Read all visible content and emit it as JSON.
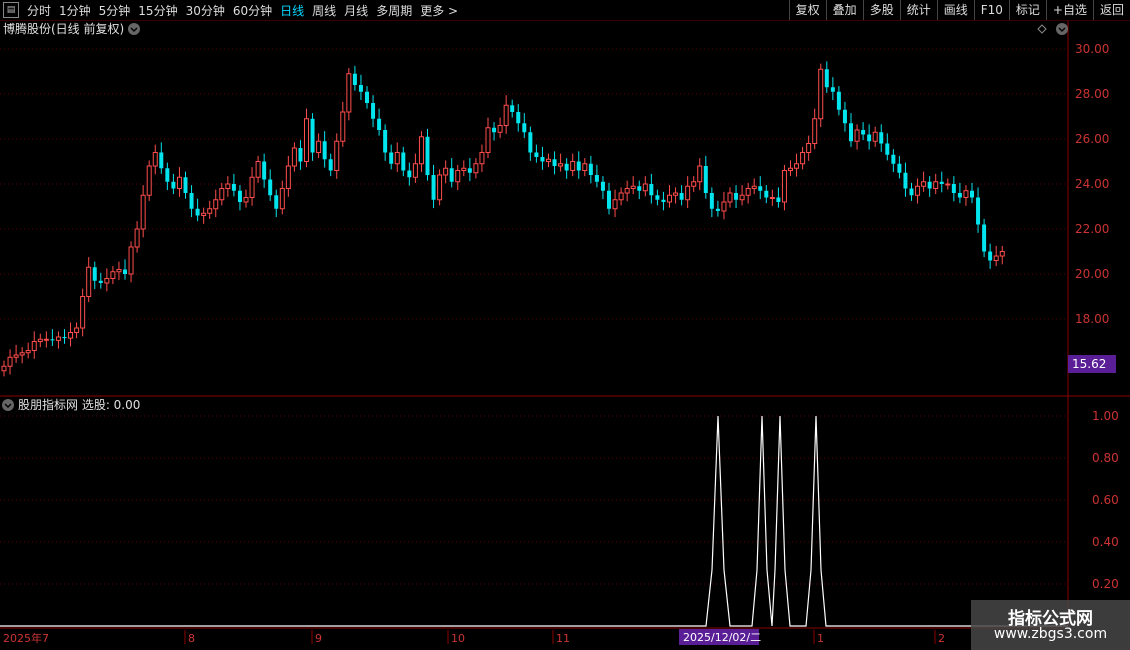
{
  "toolbar": {
    "periods": [
      "分时",
      "1分钟",
      "5分钟",
      "15分钟",
      "30分钟",
      "60分钟",
      "日线",
      "周线",
      "月线",
      "多周期",
      "更多 >"
    ],
    "active_period": "日线",
    "tools": [
      "复权",
      "叠加",
      "多股",
      "统计",
      "画线",
      "F10",
      "标记",
      "+自选",
      "返回"
    ]
  },
  "main_chart": {
    "title": "博腾股份(日线 前复权)",
    "price_ticks": [
      "30.00",
      "28.00",
      "26.00",
      "24.00",
      "22.00",
      "20.00",
      "18.00"
    ],
    "current_price_badge": "15.62"
  },
  "indicator": {
    "title": "股朋指标网 选股: 0.00",
    "ticks": [
      "1.00",
      "0.80",
      "0.60",
      "0.40",
      "0.20"
    ]
  },
  "date_axis": {
    "labels": [
      "2025年7",
      "8",
      "9",
      "10",
      "11",
      "1",
      "2"
    ],
    "cursor_date": "2025/12/02/二"
  },
  "watermark": {
    "title": "指标公式网",
    "url": "www.zbgs3.com"
  },
  "colors": {
    "up": "#ff4d4d",
    "down": "#00e5ee",
    "axis": "#8b0000",
    "grid": "#5a0000",
    "signal": "#ffffff",
    "badge": "#5a1e96"
  },
  "chart_data": {
    "type": "candlestick",
    "close": [
      15.9,
      16.3,
      16.4,
      16.5,
      16.6,
      17.0,
      17.1,
      17.1,
      17.05,
      17.2,
      17.15,
      17.4,
      17.6,
      19.0,
      20.3,
      19.7,
      19.6,
      19.8,
      20.1,
      20.2,
      20.0,
      21.2,
      22.0,
      23.5,
      24.8,
      25.4,
      24.7,
      24.1,
      23.8,
      24.3,
      23.6,
      22.9,
      22.6,
      22.7,
      22.9,
      23.3,
      23.8,
      24.0,
      23.7,
      23.2,
      23.4,
      24.3,
      25.0,
      24.2,
      23.5,
      22.9,
      23.8,
      24.8,
      25.6,
      25.0,
      26.9,
      25.4,
      25.9,
      25.1,
      24.6,
      25.9,
      27.2,
      28.9,
      28.4,
      28.1,
      27.6,
      26.9,
      26.4,
      25.4,
      24.9,
      25.4,
      24.6,
      24.3,
      24.9,
      26.1,
      24.4,
      23.3,
      24.4,
      24.7,
      24.1,
      24.6,
      24.7,
      24.5,
      24.9,
      25.4,
      26.5,
      26.3,
      26.6,
      27.5,
      27.2,
      26.7,
      26.3,
      25.4,
      25.2,
      25.0,
      25.1,
      24.8,
      24.9,
      24.6,
      25.0,
      24.6,
      24.9,
      24.4,
      24.1,
      23.7,
      22.9,
      23.3,
      23.6,
      23.8,
      23.9,
      23.7,
      24.0,
      23.5,
      23.3,
      23.2,
      23.5,
      23.6,
      23.3,
      23.9,
      24.1,
      24.8,
      23.6,
      22.9,
      22.8,
      23.2,
      23.6,
      23.3,
      23.5,
      23.8,
      23.9,
      23.7,
      23.4,
      23.4,
      23.2,
      24.6,
      24.7,
      24.9,
      25.4,
      25.8,
      26.9,
      29.1,
      28.3,
      28.1,
      27.3,
      26.7,
      25.9,
      26.4,
      26.2,
      25.9,
      26.3,
      25.8,
      25.3,
      24.9,
      24.5,
      23.8,
      23.5,
      23.9,
      24.1,
      23.8,
      24.1,
      24.0,
      24.0,
      23.6,
      23.4,
      23.7,
      23.4,
      22.2,
      21.0,
      20.6,
      20.8,
      21.0
    ]
  }
}
